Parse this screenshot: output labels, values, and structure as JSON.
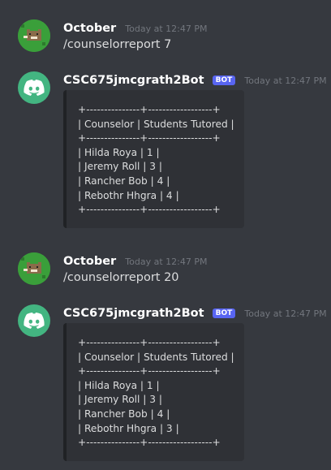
{
  "messages": [
    {
      "author": "October",
      "timestamp": "Today at 12:47 PM",
      "text": "/counselorreport 7"
    },
    {
      "author": "CSC675jmcgrath2Bot",
      "badge": "BOT",
      "timestamp": "Today at 12:47 PM",
      "lines": [
        "+---------------+------------------+",
        "| Counselor | Students Tutored |",
        "+---------------+------------------+",
        "| Hilda Roya | 1 |",
        "| Jeremy Roll | 3 |",
        "| Rancher Bob | 4 |",
        "| Rebothr Hhgra | 4 |",
        "+---------------+------------------+"
      ]
    },
    {
      "author": "October",
      "timestamp": "Today at 12:47 PM",
      "text": "/counselorreport 20"
    },
    {
      "author": "CSC675jmcgrath2Bot",
      "badge": "BOT",
      "timestamp": "Today at 12:47 PM",
      "lines": [
        "+---------------+------------------+",
        "| Counselor | Students Tutored |",
        "+---------------+------------------+",
        "| Hilda Roya | 1 |",
        "| Jeremy Roll | 3 |",
        "| Rancher Bob | 4 |",
        "| Rebothr Hhgra | 3 |",
        "+---------------+------------------+"
      ]
    }
  ],
  "colors": {
    "background": "#36393f",
    "codeblock": "#2f3136",
    "bot_badge": "#5865f2",
    "bot_avatar": "#43b581",
    "user_avatar": "#3a9f3a"
  }
}
